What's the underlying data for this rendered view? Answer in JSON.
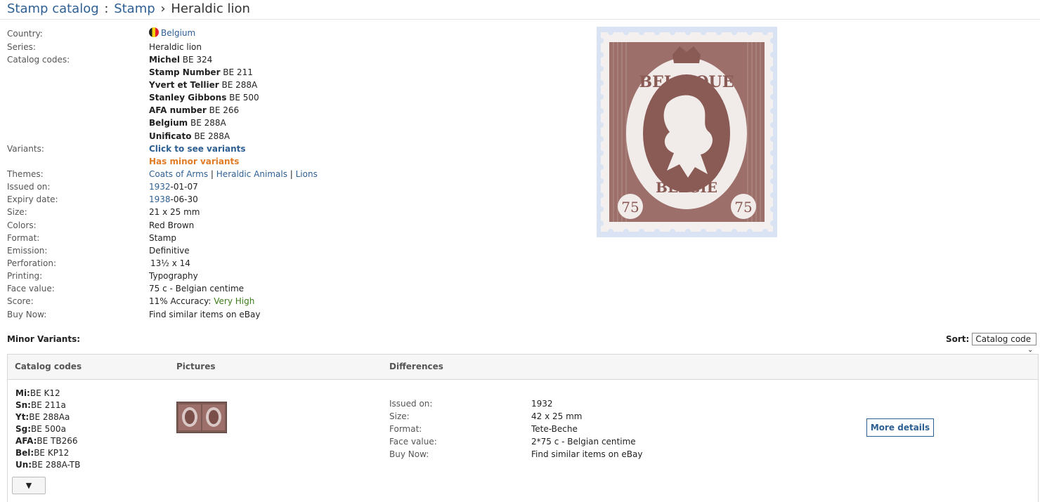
{
  "breadcrumb": {
    "root": "Stamp catalog",
    "colon": ":",
    "section": "Stamp",
    "arrow": "›",
    "current": "Heraldic lion"
  },
  "details": {
    "country_label": "Country:",
    "country": "Belgium",
    "series_label": "Series:",
    "series": "Heraldic lion",
    "catalog_label": "Catalog codes:",
    "catalog_codes": [
      {
        "name": "Michel",
        "code": " BE 324"
      },
      {
        "name": "Stamp Number",
        "code": " BE 211"
      },
      {
        "name": "Yvert et Tellier",
        "code": " BE 288A"
      },
      {
        "name": "Stanley Gibbons",
        "code": " BE 500"
      },
      {
        "name": "AFA number",
        "code": " BE 266"
      },
      {
        "name": "Belgium",
        "code": " BE 288A"
      },
      {
        "name": "Unificato",
        "code": " BE 288A"
      }
    ],
    "variants_label": "Variants:",
    "variants_link": "Click to see variants",
    "minor_variants": "Has minor variants",
    "themes_label": "Themes:",
    "themes": [
      "Coats of Arms",
      "Heraldic Animals",
      "Lions"
    ],
    "theme_sep": " | ",
    "issued_label": "Issued on:",
    "issued_year": "1932",
    "issued_rest": "-01-07",
    "expiry_label": "Expiry date:",
    "expiry_year": "1938",
    "expiry_rest": "-06-30",
    "size_label": "Size:",
    "size": "21 x 25 mm",
    "colors_label": "Colors:",
    "colors": "Red Brown",
    "format_label": "Format:",
    "format": "Stamp",
    "emission_label": "Emission:",
    "emission": "Definitive",
    "perforation_label": "Perforation:",
    "perforation": "13½ x 14",
    "printing_label": "Printing:",
    "printing": "Typography",
    "face_label": "Face value:",
    "face": "75 c - Belgian centime",
    "score_label": "Score:",
    "score": "11% Accuracy: ",
    "score_level": "Very High",
    "buy_label": "Buy Now:",
    "buy": "Find similar items on eBay"
  },
  "stamp_image": {
    "top_text": "BELGIQUE",
    "bottom_text": "BELGIE",
    "value_left": "75",
    "value_right": "75",
    "color": "#8a5a55"
  },
  "minor": {
    "title": "Minor Variants:",
    "sort_label": "Sort:",
    "sort_value": "Catalog code",
    "headers": {
      "codes": "Catalog codes",
      "pictures": "Pictures",
      "differences": "Differences"
    },
    "row": {
      "codes": [
        {
          "k": "Mi:",
          "v": "BE K12"
        },
        {
          "k": "Sn:",
          "v": "BE 211a"
        },
        {
          "k": "Yt:",
          "v": "BE 288Aa"
        },
        {
          "k": "Sg:",
          "v": "BE 500a"
        },
        {
          "k": "AFA:",
          "v": "BE TB266"
        },
        {
          "k": "Bel:",
          "v": "BE KP12"
        },
        {
          "k": "Un:",
          "v": "BE 288A-TB"
        }
      ],
      "issued_label": "Issued on:",
      "issued": "1932",
      "size_label": "Size:",
      "size": "42 x 25 mm",
      "format_label": "Format:",
      "format": "Tete-Beche",
      "face_label": "Face value:",
      "face": "2*75 c - Belgian centime",
      "buy_label": "Buy Now:",
      "buy": "Find similar items on eBay",
      "more": "More details",
      "expand": "▼"
    }
  }
}
